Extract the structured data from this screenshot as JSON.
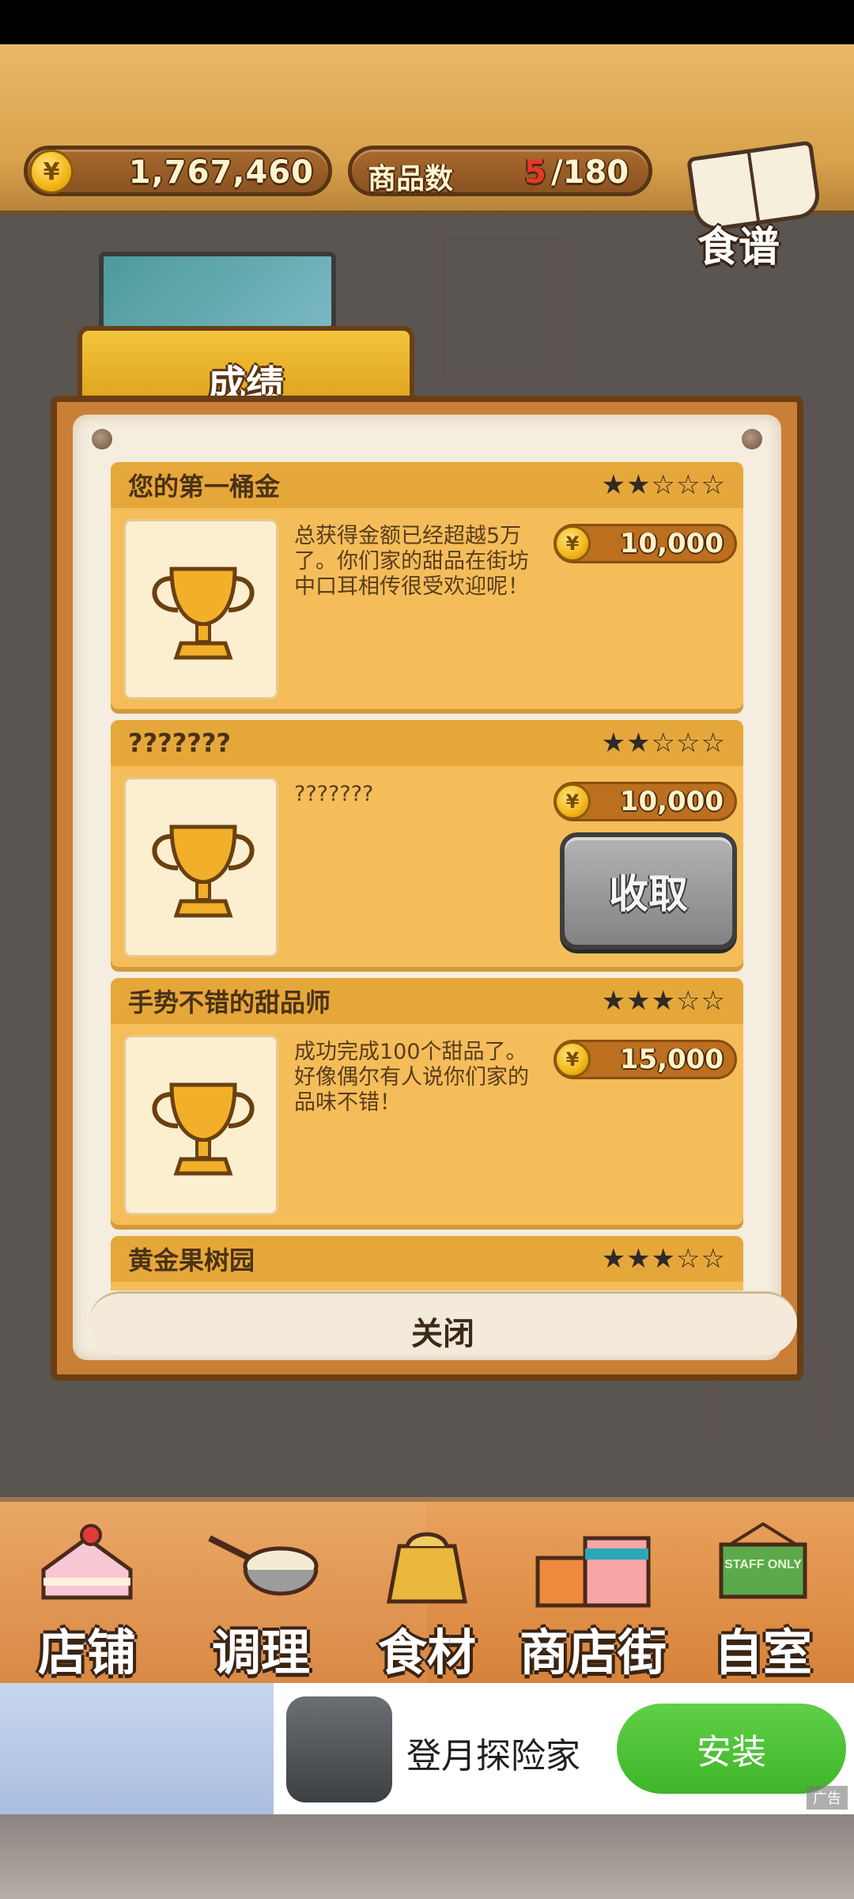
{
  "hud": {
    "money": "1,767,460",
    "product_label": "商品数",
    "product_current": "5",
    "product_total": "/180",
    "recipe_label": "食谱",
    "coin_symbol": "¥"
  },
  "panel": {
    "tab_title": "成绩",
    "close_label": "关闭"
  },
  "achievements": [
    {
      "title": "您的第一桶金",
      "stars": "★★☆☆☆",
      "rating": 2,
      "description": "总获得金额已经超越5万了。你们家的甜品在街坊中口耳相传很受欢迎呢！",
      "reward": "10,000",
      "claimable": false
    },
    {
      "title": "???????",
      "stars": "★★☆☆☆",
      "rating": 2,
      "description": "???????",
      "reward": "10,000",
      "claimable": true,
      "claim_label": "收取"
    },
    {
      "title": "手势不错的甜品师",
      "stars": "★★★☆☆",
      "rating": 3,
      "description": "成功完成100个甜品了。好像偶尔有人说你们家的品味不错！",
      "reward": "15,000",
      "claimable": false
    },
    {
      "title": "黄金果树园",
      "stars": "★★★☆☆",
      "rating": 3,
      "description": "",
      "reward": "",
      "claimable": false
    }
  ],
  "nav": {
    "items": [
      {
        "label": "店铺",
        "icon": "cake-icon"
      },
      {
        "label": "调理",
        "icon": "mixing-bowl-icon"
      },
      {
        "label": "食材",
        "icon": "ingredient-bag-icon"
      },
      {
        "label": "商店街",
        "icon": "shop-street-icon"
      },
      {
        "label": "自室",
        "icon": "staff-only-sign-icon"
      }
    ],
    "staff_sign_text": "STAFF ONLY"
  },
  "ad": {
    "app_name": "登月探险家",
    "install_label": "安装",
    "tag": "广告"
  },
  "colors": {
    "accent_gold": "#f3c43b",
    "card_bg": "#f4bd5a",
    "count_red": "#e6372a",
    "install_green": "#3fb52a"
  }
}
